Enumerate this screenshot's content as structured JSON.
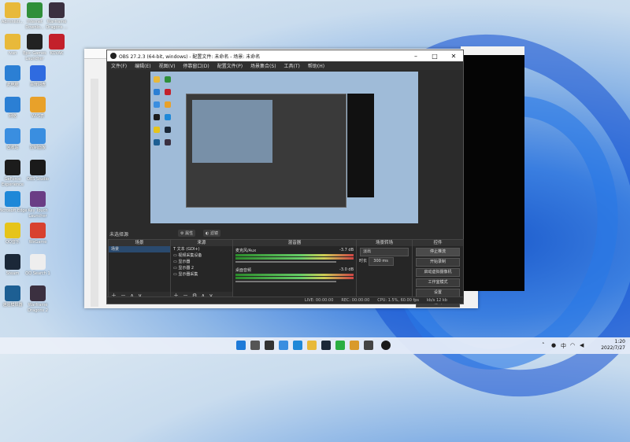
{
  "desktop": {
    "icons": [
      {
        "label": "Administr...",
        "icon": "folder-icon",
        "color": "#e8b93a"
      },
      {
        "label": "Internet Downlo...",
        "icon": "idm-icon",
        "color": "#2f8f3a"
      },
      {
        "label": "Warframe Dragons ...",
        "icon": "game-icon",
        "color": "#3b3040"
      },
      {
        "label": "Ivan",
        "icon": "folder-icon",
        "color": "#e8b93a"
      },
      {
        "label": "Epic Games Launcher",
        "icon": "epic-icon",
        "color": "#222222"
      },
      {
        "label": "KOVAK",
        "icon": "kovak-icon",
        "color": "#c3202b"
      },
      {
        "label": "此电脑",
        "icon": "pc-icon",
        "color": "#2b7fd4"
      },
      {
        "label": "百度网盘",
        "icon": "baidu-icon",
        "color": "#2f6be0"
      },
      {
        "label": "网络",
        "icon": "network-icon",
        "color": "#2b7fd4"
      },
      {
        "label": "WPS表",
        "icon": "wps-icon",
        "color": "#e8a12a"
      },
      {
        "label": "回收站",
        "icon": "recycle-icon",
        "color": "#3a8ee0"
      },
      {
        "label": "控制面板",
        "icon": "control-icon",
        "color": "#3a8ee0"
      },
      {
        "label": "GeForce Experience",
        "icon": "nvidia-icon",
        "color": "#1c1c1c"
      },
      {
        "label": "OBS Studio",
        "icon": "obs-icon",
        "color": "#1a1a1a"
      },
      {
        "label": "Microsoft Edge",
        "icon": "edge-icon",
        "color": "#1e88d8"
      },
      {
        "label": "Key Touch Launcher",
        "icon": "game-icon",
        "color": "#6a3d85"
      },
      {
        "label": "QQ音乐",
        "icon": "qqmusic-icon",
        "color": "#e6c41a"
      },
      {
        "label": "WeGame",
        "icon": "wegame-icon",
        "color": "#d8412f"
      },
      {
        "label": "Steam",
        "icon": "steam-icon",
        "color": "#1b2838"
      },
      {
        "label": "QQ Search 1",
        "icon": "doc-icon",
        "color": "#eeeeee"
      },
      {
        "label": "逍遥模拟器",
        "icon": "emulator-icon",
        "color": "#1d5f93"
      },
      {
        "label": "Warframe Dragons 2",
        "icon": "game-icon",
        "color": "#3b3040"
      }
    ]
  },
  "obs": {
    "title": "OBS 27.2.3 (64-bit, windows) - 配置文件: 未命名 - 场景: 未命名",
    "menu": [
      "文件(F)",
      "编辑(E)",
      "视图(V)",
      "停靠窗口(D)",
      "配置文件(P)",
      "场景集合(S)",
      "工具(T)",
      "帮助(H)"
    ],
    "source_label": "未选择源",
    "props_button": "属性",
    "filters_button": "滤镜",
    "docks": {
      "scenes": {
        "title": "场景",
        "items": [
          "场景"
        ]
      },
      "sources": {
        "title": "来源",
        "items": [
          "文本 (GDI+)",
          "视频采集设备",
          "显示器",
          "显示器 2",
          "显示器采集"
        ]
      },
      "mixer": {
        "title": "混音器",
        "tracks": [
          {
            "name": "麦克风/Aux",
            "db": "-3.7 dB"
          },
          {
            "name": "桌面音频",
            "db": "-3.0 dB"
          }
        ]
      },
      "transitions": {
        "title": "场景转场",
        "type": "淡出",
        "duration_label": "时长",
        "duration": "300 ms"
      },
      "controls": {
        "title": "控件",
        "buttons": [
          "停止推流",
          "开始录制",
          "启动虚拟摄像机",
          "工作室模式",
          "设置",
          "退出"
        ]
      }
    },
    "status": {
      "live": "LIVE: 00:00:00",
      "rec": "REC: 00:00:00",
      "cpu": "CPU: 1.5%, 60.00 fps",
      "bitrate": "kb/s 12 kb"
    }
  },
  "taskbar": {
    "time": "1:20",
    "date": "2022/7/27",
    "icons": [
      "windows-icon",
      "search-icon",
      "taskview-icon",
      "widgets-icon",
      "edge-icon",
      "explorer-icon",
      "steam-icon",
      "wechat-icon",
      "game-icon",
      "obs-icon"
    ]
  }
}
